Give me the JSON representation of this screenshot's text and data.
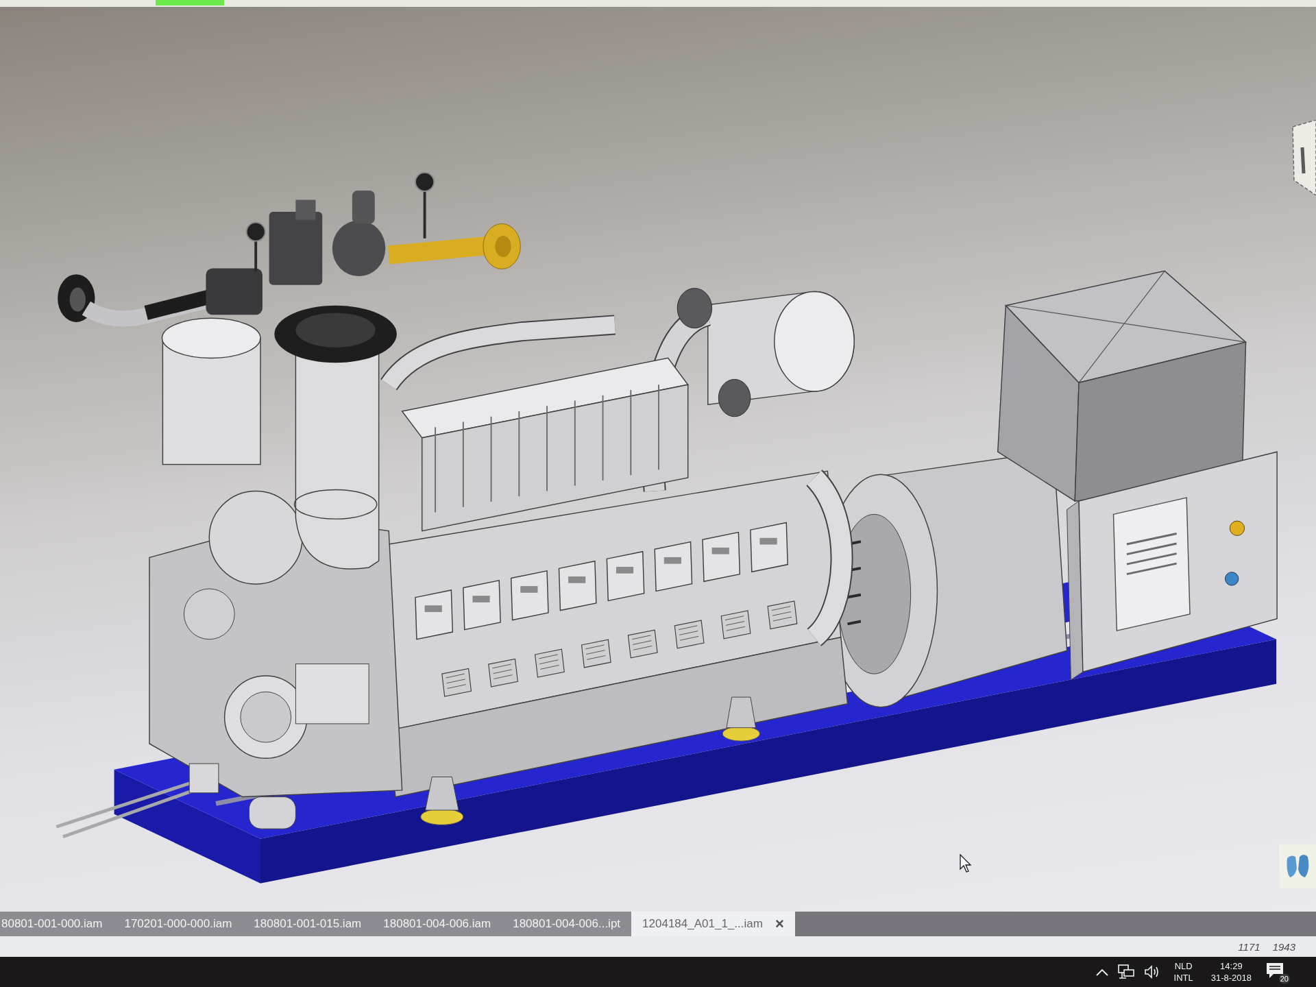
{
  "document_tabs": [
    {
      "label": "80801-001-000.iam",
      "selected": false
    },
    {
      "label": "170201-000-000.iam",
      "selected": false
    },
    {
      "label": "180801-001-015.iam",
      "selected": false
    },
    {
      "label": "180801-004-006.iam",
      "selected": false
    },
    {
      "label": "180801-004-006...ipt",
      "selected": false
    },
    {
      "label": "1204184_A01_1_...iam",
      "selected": true,
      "close": "×"
    }
  ],
  "status_bar": {
    "values": [
      "1171",
      "1943"
    ]
  },
  "taskbar": {
    "language": {
      "code": "NLD",
      "layout": "INTL"
    },
    "clock": {
      "time": "14:29",
      "date": "31-8-2018"
    },
    "notification_count": "20"
  }
}
